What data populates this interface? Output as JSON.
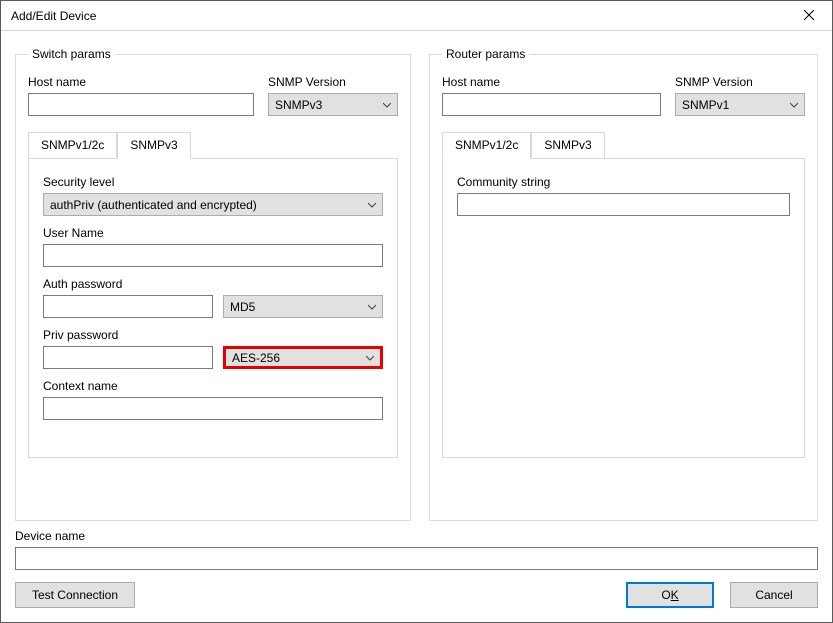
{
  "window": {
    "title": "Add/Edit Device"
  },
  "switch": {
    "legend": "Switch params",
    "host_label": "Host name",
    "host_value": "",
    "snmp_version_label": "SNMP Version",
    "snmp_version_value": "SNMPv3",
    "tabs": {
      "v1": "SNMPv1/2c",
      "v3": "SNMPv3",
      "active": "v3"
    },
    "v3": {
      "security_level_label": "Security level",
      "security_level_value": "authPriv (authenticated and encrypted)",
      "user_name_label": "User Name",
      "user_name_value": "",
      "auth_pass_label": "Auth password",
      "auth_pass_value": "",
      "auth_algo_value": "MD5",
      "priv_pass_label": "Priv password",
      "priv_pass_value": "",
      "priv_algo_value": "AES-256",
      "context_label": "Context name",
      "context_value": ""
    }
  },
  "router": {
    "legend": "Router params",
    "host_label": "Host name",
    "host_value": "",
    "snmp_version_label": "SNMP Version",
    "snmp_version_value": "SNMPv1",
    "tabs": {
      "v1": "SNMPv1/2c",
      "v3": "SNMPv3",
      "active": "v1"
    },
    "v1": {
      "community_label": "Community string",
      "community_value": ""
    }
  },
  "device_name_label": "Device name",
  "device_name_value": "",
  "buttons": {
    "test": "Test Connection",
    "ok_prefix": "O",
    "ok_underline": "K",
    "cancel": "Cancel"
  }
}
